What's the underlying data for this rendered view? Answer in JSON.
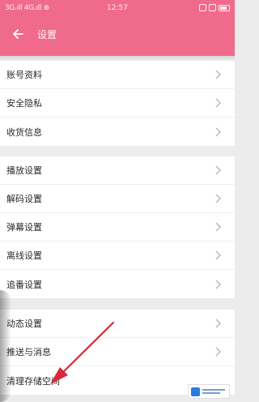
{
  "status_bar": {
    "left": "3G.ıll 4G.ıll ⊕",
    "time": "12:57"
  },
  "header": {
    "title": "设置"
  },
  "groups": [
    {
      "items": [
        {
          "label": "账号资料"
        },
        {
          "label": "安全隐私"
        },
        {
          "label": "收货信息"
        }
      ]
    },
    {
      "items": [
        {
          "label": "播放设置"
        },
        {
          "label": "解码设置"
        },
        {
          "label": "弹幕设置"
        },
        {
          "label": "离线设置"
        },
        {
          "label": "追番设置"
        }
      ]
    },
    {
      "items": [
        {
          "label": "动态设置"
        },
        {
          "label": "推送与消息"
        },
        {
          "label": "清理存储空间"
        }
      ]
    }
  ],
  "colors": {
    "accent": "#f06a8c",
    "annotation_arrow": "#d8283a"
  },
  "icons": {
    "back": "arrow-left-icon",
    "row_chevron": "chevron-right-icon"
  }
}
